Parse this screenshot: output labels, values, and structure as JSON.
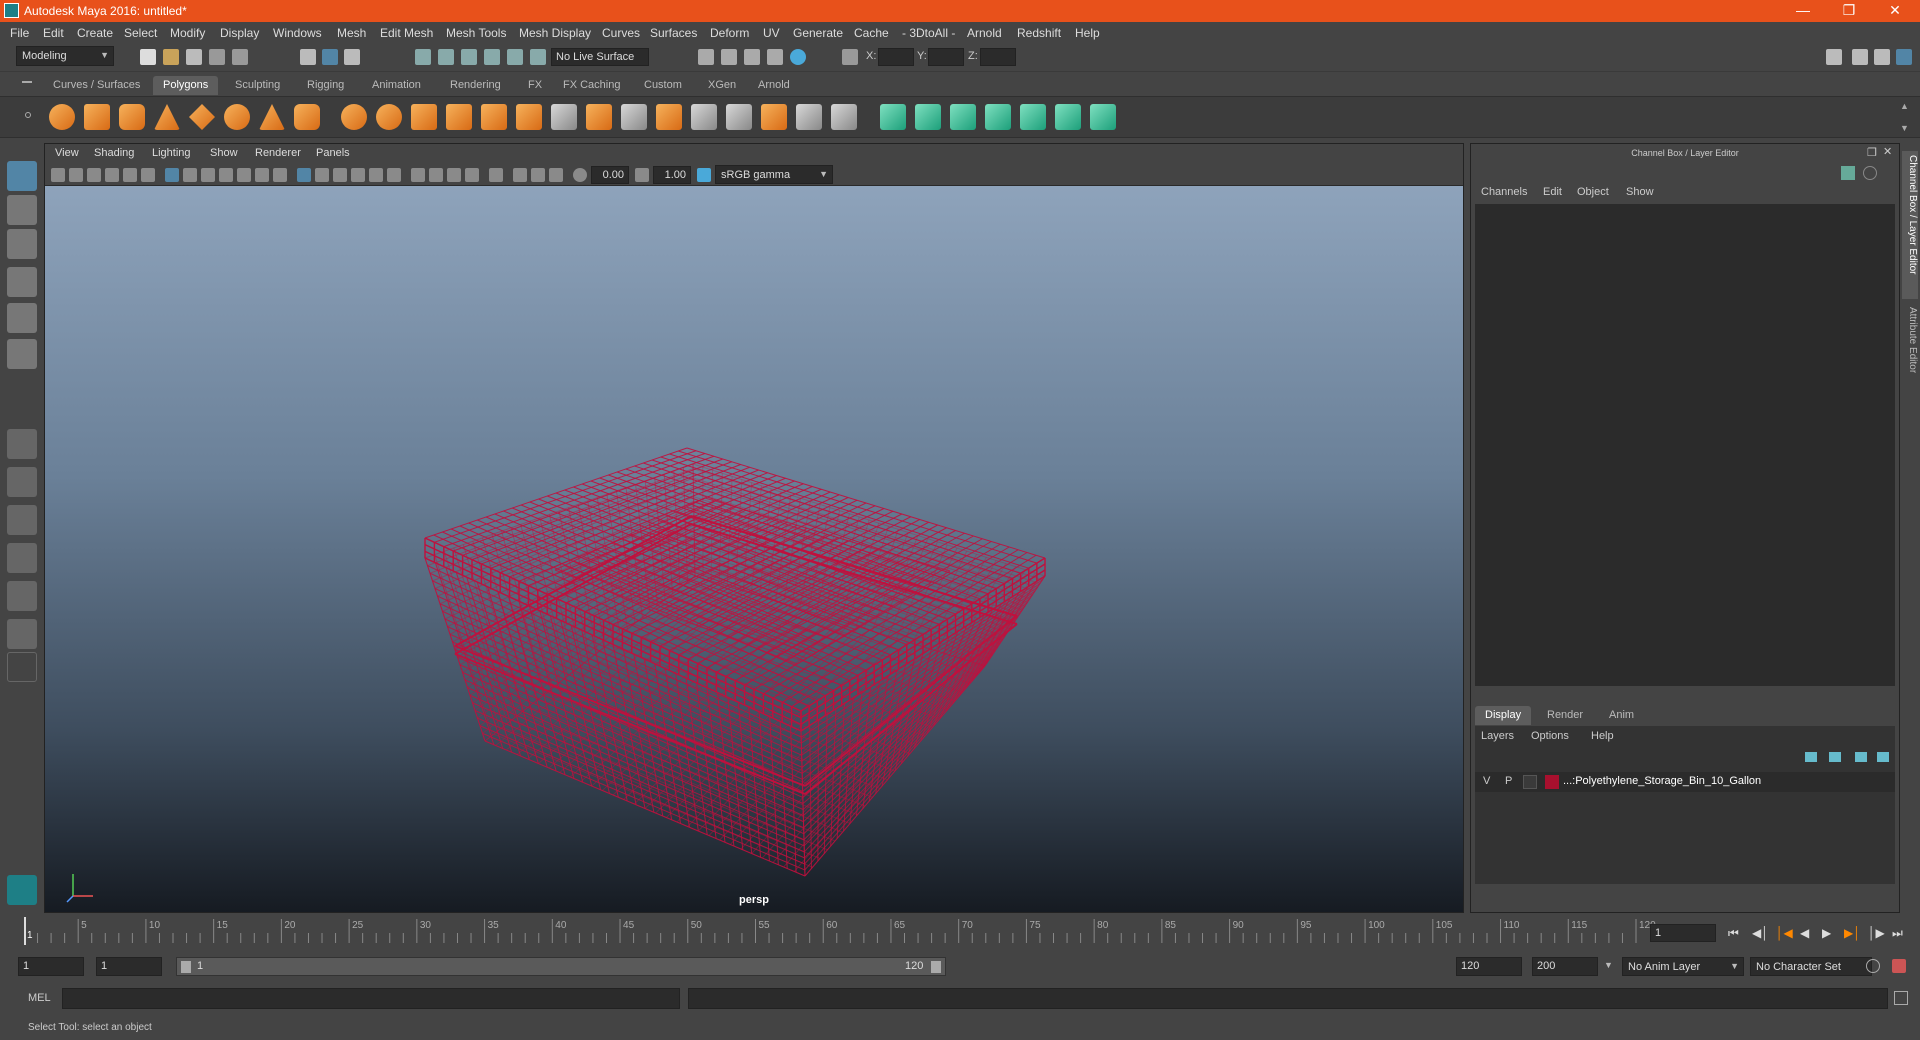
{
  "window": {
    "title": "Autodesk Maya 2016: untitled*"
  },
  "menu": [
    "File",
    "Edit",
    "Create",
    "Select",
    "Modify",
    "Display",
    "Windows",
    "Mesh",
    "Edit Mesh",
    "Mesh Tools",
    "Mesh Display",
    "Curves",
    "Surfaces",
    "Deform",
    "UV",
    "Generate",
    "Cache",
    "- 3DtoAll -",
    "Arnold",
    "Redshift",
    "Help"
  ],
  "status": {
    "mode": "Modeling",
    "live_surface": "No Live Surface",
    "x_label": "X:",
    "y_label": "Y:",
    "z_label": "Z:"
  },
  "shelf_tabs": [
    "Curves / Surfaces",
    "Polygons",
    "Sculpting",
    "Rigging",
    "Animation",
    "Rendering",
    "FX",
    "FX Caching",
    "Custom",
    "XGen",
    "Arnold"
  ],
  "viewport": {
    "menu": [
      "View",
      "Shading",
      "Lighting",
      "Show",
      "Renderer",
      "Panels"
    ],
    "exposure": "0.00",
    "gamma": "1.00",
    "color_space": "sRGB gamma",
    "camera": "persp",
    "wire_color": "#c0103d"
  },
  "channel_box": {
    "header": "Channel Box / Layer Editor",
    "menu": [
      "Channels",
      "Edit",
      "Object",
      "Show"
    ]
  },
  "layer_editor": {
    "tabs": [
      "Display",
      "Render",
      "Anim"
    ],
    "menu": [
      "Layers",
      "Options",
      "Help"
    ],
    "layer": {
      "v": "V",
      "p": "P",
      "name": "...:Polyethylene_Storage_Bin_10_Gallon",
      "color": "#a8102e"
    }
  },
  "side_tabs": [
    "Channel Box / Layer Editor",
    "Attribute Editor"
  ],
  "timeline": {
    "ticks": [
      "5",
      "10",
      "15",
      "20",
      "25",
      "30",
      "35",
      "40",
      "45",
      "50",
      "55",
      "60",
      "65",
      "70",
      "75",
      "80",
      "85",
      "90",
      "95",
      "100",
      "105",
      "110",
      "115",
      "120"
    ],
    "start_marker": "1",
    "current_frame": "1"
  },
  "range": {
    "start": "1",
    "playback_start": "1",
    "slider_start": "1",
    "slider_end": "120",
    "playback_end": "120",
    "end": "200",
    "anim_layer": "No Anim Layer",
    "char_set": "No Character Set"
  },
  "cmd": {
    "label": "MEL"
  },
  "help": {
    "text": "Select Tool: select an object"
  }
}
